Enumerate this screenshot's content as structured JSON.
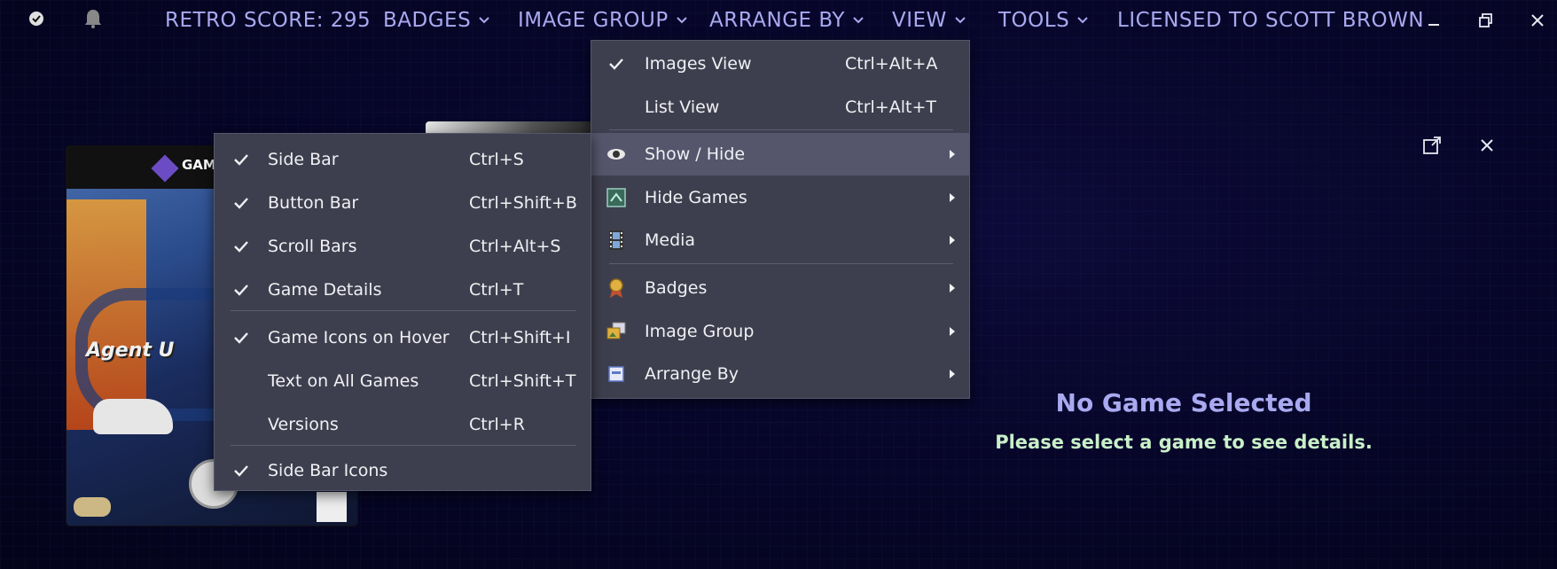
{
  "topbar": {
    "retro_score": "RETRO SCORE: 295",
    "badges": "BADGES",
    "image_group": "IMAGE GROUP",
    "arrange_by": "ARRANGE BY",
    "view": "VIEW",
    "tools": "TOOLS",
    "licensed": "LICENSED TO SCOTT BROWN"
  },
  "cover": {
    "title_text": "Agent U",
    "platform_text": "GAM"
  },
  "details": {
    "title": "No Game Selected",
    "subtitle": "Please select a game to see details."
  },
  "view_menu": {
    "items": [
      {
        "label": "Images View",
        "shortcut": "Ctrl+Alt+A",
        "checked": true
      },
      {
        "label": "List View",
        "shortcut": "Ctrl+Alt+T",
        "checked": false
      },
      {
        "label": "Show / Hide",
        "icon": "eye-icon",
        "submenu": true,
        "highlighted": true
      },
      {
        "label": "Hide Games",
        "icon": "hide-games-icon",
        "submenu": true
      },
      {
        "label": "Media",
        "icon": "film-icon",
        "submenu": true
      },
      {
        "label": "Badges",
        "icon": "badge-medal-icon",
        "submenu": true
      },
      {
        "label": "Image Group",
        "icon": "image-group-icon",
        "submenu": true
      },
      {
        "label": "Arrange By",
        "icon": "arrange-icon",
        "submenu": true
      }
    ]
  },
  "show_hide_menu": {
    "items": [
      {
        "label": "Side Bar",
        "shortcut": "Ctrl+S",
        "checked": true
      },
      {
        "label": "Button Bar",
        "shortcut": "Ctrl+Shift+B",
        "checked": true
      },
      {
        "label": "Scroll Bars",
        "shortcut": "Ctrl+Alt+S",
        "checked": true
      },
      {
        "label": "Game Details",
        "shortcut": "Ctrl+T",
        "checked": true
      },
      {
        "label": "Game Icons on Hover",
        "shortcut": "Ctrl+Shift+I",
        "checked": true
      },
      {
        "label": "Text on All Games",
        "shortcut": "Ctrl+Shift+T",
        "checked": false
      },
      {
        "label": "Versions",
        "shortcut": "Ctrl+R",
        "checked": false
      },
      {
        "label": "Side Bar Icons",
        "shortcut": "",
        "checked": true
      }
    ]
  },
  "colors": {
    "topbar_text": "#a9a9f0",
    "menu_bg": "#3e3f4e",
    "menu_highlight": "#55566c",
    "subtitle_green": "#c8f0c8"
  }
}
